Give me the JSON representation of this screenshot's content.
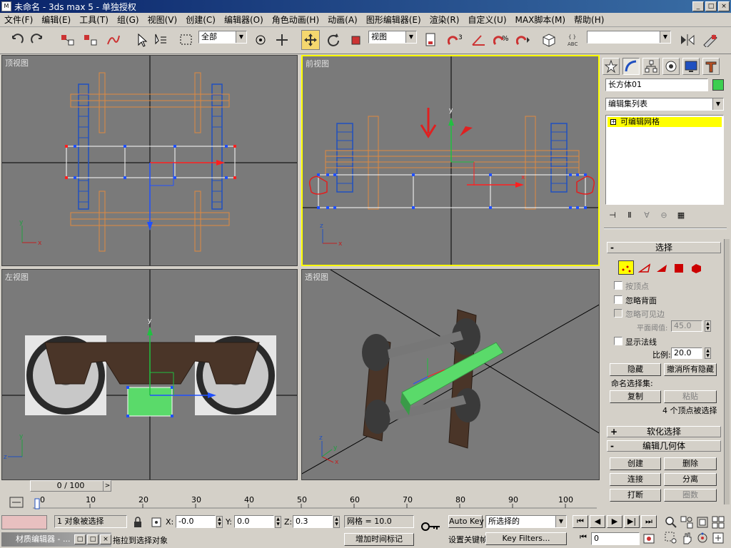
{
  "window": {
    "title": "未命名 - 3ds max 5 - 单独授权",
    "app_icon": "3ds-max-icon",
    "controls": {
      "minimize": "_",
      "maximize": "□",
      "close": "×"
    }
  },
  "menu": [
    "文件(F)",
    "编辑(E)",
    "工具(T)",
    "组(G)",
    "视图(V)",
    "创建(C)",
    "编辑器(O)",
    "角色动画(H)",
    "动画(A)",
    "图形编辑器(E)",
    "渲染(R)",
    "自定义(U)",
    "MAX脚本(M)",
    "帮助(H)"
  ],
  "toolbar": {
    "selection_filter": "全部",
    "reference_coord": "视图",
    "named_selection": ""
  },
  "viewports": {
    "top": {
      "label": "顶视图"
    },
    "front": {
      "label": "前视图",
      "axis_labels": [
        "y",
        "x"
      ]
    },
    "left": {
      "label": "左视图"
    },
    "perspective": {
      "label": "透视图"
    }
  },
  "axis_labels": {
    "x": "x",
    "y": "y",
    "z": "z"
  },
  "command_panel": {
    "object_name": "长方体01",
    "object_color": "#3ccf50",
    "modifier_list": "编辑集列表",
    "stack_item": "可编辑网格",
    "selection_rollout": {
      "title": "选择",
      "by_vertex": "按顶点",
      "ignore_backfacing": "忽略背面",
      "ignore_visible_edges": "忽略可见边",
      "planar_threshold_label": "平面阈值:",
      "planar_threshold": "45.0",
      "show_normals": "显示法线",
      "scale_label": "比例:",
      "scale": "20.0",
      "hide": "隐藏",
      "unhide_all": "撤消所有隐藏",
      "named_sets": "命名选择集:",
      "copy": "复制",
      "paste": "粘贴",
      "status": "4 个顶点被选择"
    },
    "soft_selection": "软化选择",
    "edit_geometry": {
      "title": "编辑几何体",
      "create": "创建",
      "delete": "删除",
      "attach": "连接",
      "detach": "分离",
      "break": "打断",
      "divide": "圈数"
    }
  },
  "timeline": {
    "frame_display": "0 / 100",
    "ticks": [
      "0",
      "10",
      "20",
      "30",
      "40",
      "50",
      "60",
      "70",
      "80",
      "90",
      "100"
    ]
  },
  "status": {
    "selected": "1 对象被选择",
    "prompt": "拖拉到选择对象",
    "material_editor": "材质编辑器 - ...",
    "x_label": "X:",
    "x": "-0.0",
    "y_label": "Y:",
    "y": "0.0",
    "z_label": "Z:",
    "z": "0.3",
    "grid": "网格 = 10.0",
    "add_time_tag": "增加时间标记",
    "auto_key": "Auto Key",
    "set_key": "设置关键帧",
    "key_mode": "所选择的",
    "key_filters": "Key Filters...",
    "current_frame": "0"
  }
}
